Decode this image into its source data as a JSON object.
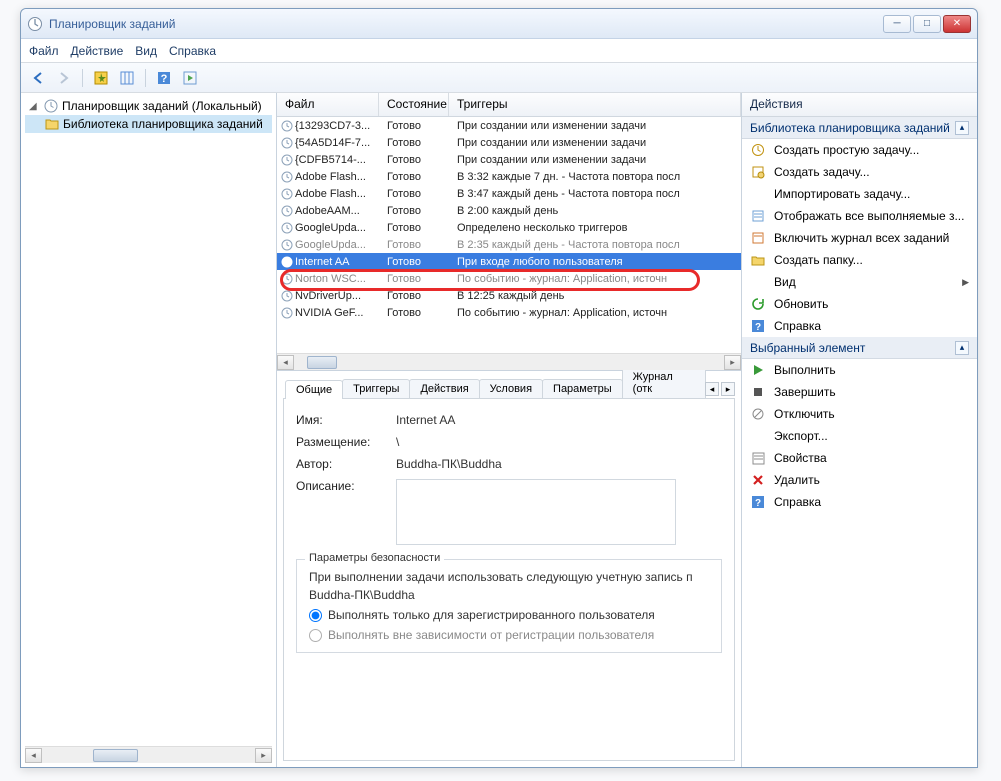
{
  "window": {
    "title": "Планировщик заданий"
  },
  "menubar": {
    "file": "Файл",
    "action": "Действие",
    "view": "Вид",
    "help": "Справка"
  },
  "tree": {
    "root": "Планировщик заданий (Локальный)",
    "library": "Библиотека планировщика заданий"
  },
  "task_columns": {
    "name": "Файл",
    "status": "Состояние",
    "triggers": "Триггеры"
  },
  "tasks": [
    {
      "name": "{13293CD7-3...",
      "status": "Готово",
      "trigger": "При создании или изменении задачи",
      "sel": false
    },
    {
      "name": "{54A5D14F-7...",
      "status": "Готово",
      "trigger": "При создании или изменении задачи",
      "sel": false
    },
    {
      "name": "{CDFB5714-...",
      "status": "Готово",
      "trigger": "При создании или изменении задачи",
      "sel": false
    },
    {
      "name": "Adobe Flash...",
      "status": "Готово",
      "trigger": "В 3:32 каждые 7 дн. - Частота повтора посл",
      "sel": false
    },
    {
      "name": "Adobe Flash...",
      "status": "Готово",
      "trigger": "В 3:47 каждый день - Частота повтора посл",
      "sel": false
    },
    {
      "name": "AdobeAAM...",
      "status": "Готово",
      "trigger": "В 2:00 каждый день",
      "sel": false
    },
    {
      "name": "GoogleUpda...",
      "status": "Готово",
      "trigger": "Определено несколько триггеров",
      "sel": false
    },
    {
      "name": "GoogleUpda...",
      "status": "Готово",
      "trigger": "В 2:35 каждый день - Частота повтора посл",
      "sel": false,
      "dim": true
    },
    {
      "name": "Internet AA",
      "status": "Готово",
      "trigger": "При входе любого пользователя",
      "sel": true
    },
    {
      "name": "Norton WSC...",
      "status": "Готово",
      "trigger": "По событию - журнал: Application, источн",
      "sel": false,
      "dim": true
    },
    {
      "name": "NvDriverUp...",
      "status": "Готово",
      "trigger": "В 12:25 каждый день",
      "sel": false
    },
    {
      "name": "NVIDIA GeF...",
      "status": "Готово",
      "trigger": "По событию - журнал: Application, источн",
      "sel": false
    }
  ],
  "tabs": {
    "general": "Общие",
    "triggers": "Триггеры",
    "actions_tab": "Действия",
    "conditions": "Условия",
    "settings": "Параметры",
    "history": "Журнал (отк"
  },
  "general": {
    "name_label": "Имя:",
    "name_value": "Internet AA",
    "location_label": "Размещение:",
    "location_value": "\\",
    "author_label": "Автор:",
    "author_value": "Buddha-ПК\\Buddha",
    "description_label": "Описание:"
  },
  "security": {
    "group_title": "Параметры безопасности",
    "run_as_text": "При выполнении задачи использовать следующую учетную запись п",
    "account": "Buddha-ПК\\Buddha",
    "opt_logged": "Выполнять только для зарегистрированного пользователя",
    "opt_any": "Выполнять вне зависимости от регистрации пользователя"
  },
  "actions": {
    "header": "Действия",
    "section_library": "Библиотека планировщика заданий",
    "create_basic": "Создать простую задачу...",
    "create_task": "Создать задачу...",
    "import_task": "Импортировать задачу...",
    "show_running": "Отображать все выполняемые з...",
    "enable_history": "Включить журнал всех заданий",
    "new_folder": "Создать папку...",
    "view": "Вид",
    "refresh": "Обновить",
    "help": "Справка",
    "section_selected": "Выбранный элемент",
    "run": "Выполнить",
    "end": "Завершить",
    "disable": "Отключить",
    "export": "Экспорт...",
    "properties": "Свойства",
    "delete": "Удалить",
    "help2": "Справка"
  }
}
